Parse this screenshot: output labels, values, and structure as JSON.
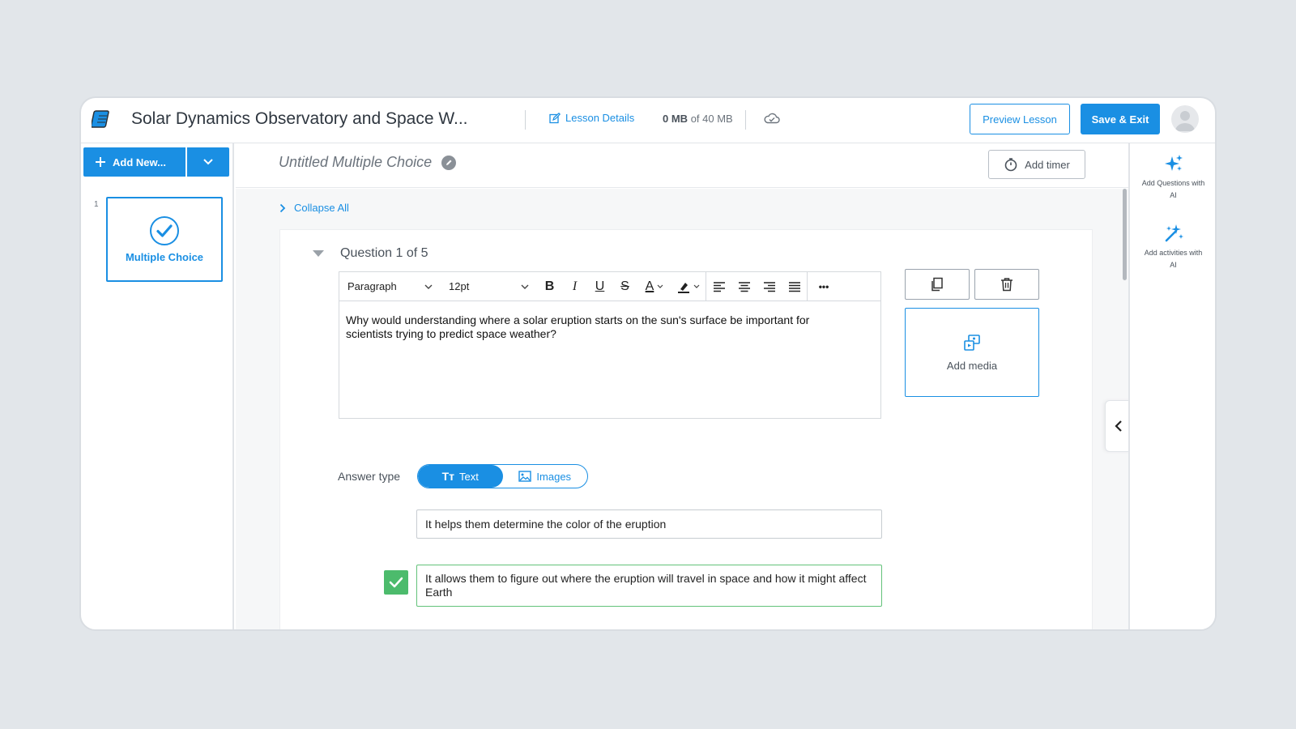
{
  "header": {
    "title": "Solar Dynamics Observatory and Space W...",
    "lesson_details": "Lesson Details",
    "storage_used": "0 MB",
    "storage_of": "of 40 MB",
    "preview_label": "Preview Lesson",
    "save_label": "Save & Exit"
  },
  "sidebar": {
    "add_new_label": "Add New...",
    "slides": [
      {
        "number": "1",
        "label": "Multiple Choice"
      }
    ]
  },
  "main": {
    "slide_title": "Untitled Multiple Choice",
    "add_timer_label": "Add timer",
    "collapse_label": "Collapse All",
    "question_header": "Question 1 of 5",
    "toolbar": {
      "block_format": "Paragraph",
      "font_size": "12pt",
      "bold": "B",
      "italic": "I",
      "underline": "U",
      "strike": "S",
      "font_color": "A",
      "more": "•••"
    },
    "question_text": "Why would understanding where a solar eruption starts on the sun's surface be important for scientists trying to predict space weather?",
    "add_media_label": "Add media",
    "answer_type_label": "Answer type",
    "answer_type_text": "Text",
    "answer_type_images": "Images",
    "answers": [
      {
        "text": "It helps them determine the color of the eruption",
        "correct": false
      },
      {
        "text": "It allows them to figure out where the eruption will travel in space and how it might affect Earth",
        "correct": true
      }
    ]
  },
  "right_panel": {
    "add_questions_ai": "Add Questions with AI",
    "add_activities_ai": "Add activities with AI"
  },
  "colors": {
    "accent": "#1a8fe3",
    "correct": "#4cbb6c",
    "background": "#e2e6ea"
  }
}
